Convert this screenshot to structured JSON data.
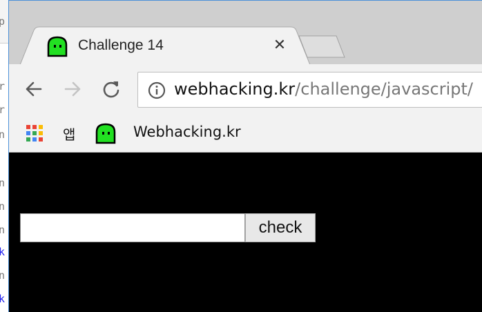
{
  "background_window": {
    "fragments": [
      "p",
      "r",
      "r",
      "n",
      "n",
      "n",
      "n",
      "k",
      "n",
      "k"
    ]
  },
  "tab": {
    "title": "Challenge 14",
    "close_glyph": "✕",
    "favicon": "green-ghost-icon"
  },
  "toolbar": {
    "url_host": "webhacking.kr",
    "url_path": "/challenge/javascript/",
    "icons": [
      "back-arrow-icon",
      "forward-arrow-icon",
      "reload-icon",
      "info-icon"
    ]
  },
  "bookmarks": {
    "apps_label": "앱",
    "items": [
      {
        "label": "Webhacking.kr",
        "icon": "green-ghost-icon"
      }
    ]
  },
  "page": {
    "input_value": "",
    "button_label": "check",
    "background": "#000000"
  },
  "colors": {
    "favicon_green": "#22e022",
    "window_border": "#4a90d9",
    "link_fragment": "#2222ee"
  }
}
